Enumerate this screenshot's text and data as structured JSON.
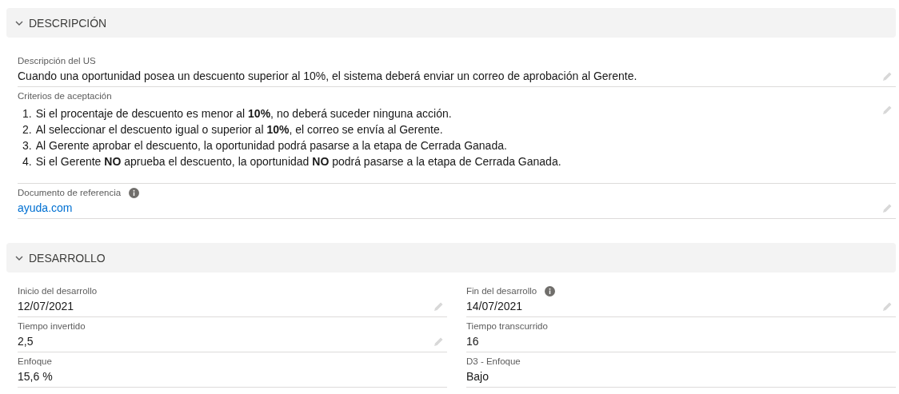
{
  "sections": [
    {
      "title": "DESCRIPCIÓN",
      "expanded": true,
      "kind": "wide",
      "fields": [
        {
          "kind": "text",
          "label": "Descripción del US",
          "value": "Cuando una oportunidad posea un descuento superior al 10%, el sistema deberá enviar un correo de aprobación al Gerente.",
          "editable": true,
          "info": false
        },
        {
          "kind": "list",
          "label": "Criterios de aceptación",
          "items": [
            {
              "marker": "1.",
              "text": "Si el procentaje de descuento es menor al **10%**, no deberá suceder ninguna acción."
            },
            {
              "marker": "2.",
              "text": "Al seleccionar el descuento igual o superior al **10%**, el correo se envía al Gerente."
            },
            {
              "marker": "3.",
              "text": "Al Gerente aprobar el descuento, la oportunidad podrá pasarse a la etapa de Cerrada Ganada."
            },
            {
              "marker": "4.",
              "text": "Si el Gerente **NO** aprueba el descuento, la oportunidad **NO** podrá pasarse a la etapa de Cerrada Ganada."
            }
          ],
          "editable": true,
          "info": false
        },
        {
          "kind": "link",
          "label": "Documento de referencia",
          "value": "ayuda.com",
          "editable": true,
          "info": true
        }
      ]
    },
    {
      "title": "DESARROLLO",
      "expanded": true,
      "kind": "grid",
      "fields": [
        {
          "kind": "text",
          "label": "Inicio del desarrollo",
          "value": "12/07/2021",
          "editable": true,
          "info": false
        },
        {
          "kind": "text",
          "label": "Fin del desarrollo",
          "value": "14/07/2021",
          "editable": true,
          "info": true
        },
        {
          "kind": "text",
          "label": "Tiempo invertido",
          "value": "2,5",
          "editable": true,
          "info": false
        },
        {
          "kind": "text",
          "label": "Tiempo transcurrido",
          "value": "16",
          "editable": false,
          "info": false
        },
        {
          "kind": "text",
          "label": "Enfoque",
          "value": "15,6 %",
          "editable": false,
          "info": false
        },
        {
          "kind": "text",
          "label": "D3 - Enfoque",
          "value": "Bajo",
          "editable": false,
          "info": false
        }
      ]
    }
  ]
}
